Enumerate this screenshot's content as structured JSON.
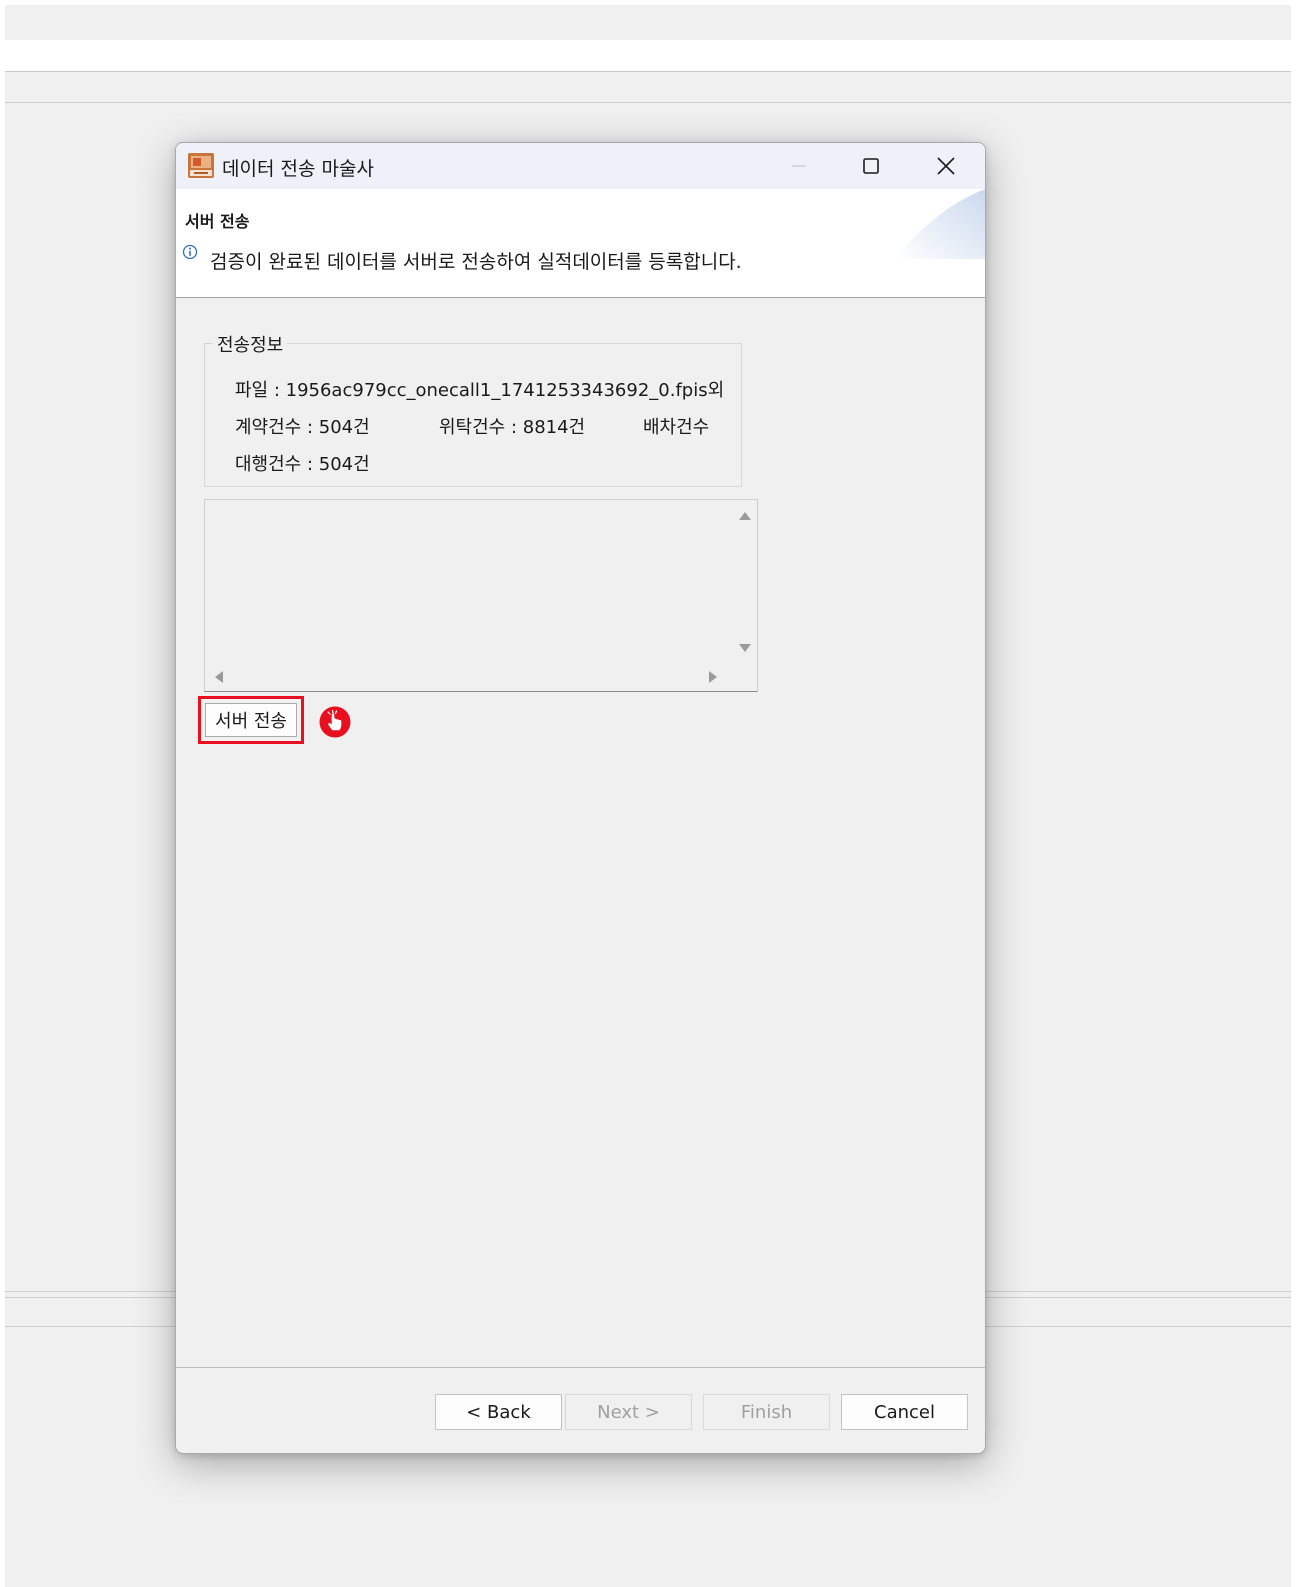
{
  "window": {
    "title": "데이터 전송 마술사",
    "app_icon": "fpis-app-icon",
    "controls": [
      "minimize-icon",
      "maximize-icon",
      "close-icon"
    ]
  },
  "header": {
    "title": "서버 전송",
    "description": "검증이 완료된 데이터를 서버로 전송하여 실적데이터를 등록합니다.",
    "icon": "info-icon"
  },
  "transfer_info": {
    "group_label": "전송정보",
    "file_line": "파일 : 1956ac979cc_onecall1_1741253343692_0.fpis외",
    "contract_count": "계약건수 : 504건",
    "consign_count": "위탁건수 : 8814건",
    "dispatch_count": "배차건수",
    "agency_count": "대행건수 : 504건"
  },
  "log_area": {
    "value": ""
  },
  "actions": {
    "send_label": "서버 전송"
  },
  "footer": {
    "back_label": "< Back",
    "next_label": "Next >",
    "finish_label": "Finish",
    "cancel_label": "Cancel",
    "next_enabled": false,
    "finish_enabled": false
  },
  "colors": {
    "highlight": "#e8101e",
    "dialog_bg": "#f0f0f0",
    "titlebar_bg": "#eef1f7",
    "disabled_text": "#a0a0a0"
  }
}
